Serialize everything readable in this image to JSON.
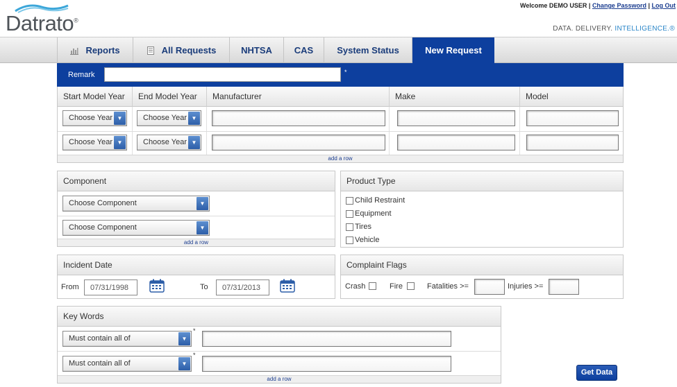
{
  "header": {
    "logo_text": "Datrato",
    "welcome": "Welcome DEMO USER",
    "change_password": "Change Password",
    "log_out": "Log Out",
    "tagline_main": "DATA. DELIVERY.",
    "tagline_accent": "INTELLIGENCE.",
    "tagline_mark": "®"
  },
  "nav": {
    "tabs": [
      {
        "label": "Reports",
        "icon": "bar-chart-icon"
      },
      {
        "label": "All Requests",
        "icon": "document-icon"
      },
      {
        "label": "NHTSA"
      },
      {
        "label": "CAS"
      },
      {
        "label": "System Status"
      },
      {
        "label": "New Request",
        "active": true
      }
    ]
  },
  "remark": {
    "label": "Remark",
    "value": "",
    "required_mark": "*"
  },
  "vehicle_table": {
    "headers": [
      "Start Model Year",
      "End Model Year",
      "Manufacturer",
      "Make",
      "Model"
    ],
    "rows": [
      {
        "start_year": "Choose Year",
        "end_year": "Choose Year",
        "manufacturer": "",
        "make": "",
        "model": ""
      },
      {
        "start_year": "Choose Year",
        "end_year": "Choose Year",
        "manufacturer": "",
        "make": "",
        "model": ""
      }
    ],
    "add_row": "add a row"
  },
  "component": {
    "title": "Component",
    "selects": [
      "Choose Component",
      "Choose Component"
    ],
    "add_row": "add a row"
  },
  "product_type": {
    "title": "Product Type",
    "options": [
      "Child Restraint",
      "Equipment",
      "Tires",
      "Vehicle"
    ]
  },
  "incident_date": {
    "title": "Incident Date",
    "from_label": "From",
    "from_value": "07/31/1998",
    "to_label": "To",
    "to_value": "07/31/2013"
  },
  "complaint_flags": {
    "title": "Complaint Flags",
    "crash_label": "Crash",
    "fire_label": "Fire",
    "fatalities_label": "Fatalities >=",
    "fatalities_value": "",
    "injuries_label": "Injuries >=",
    "injuries_value": ""
  },
  "key_words": {
    "title": "Key Words",
    "rows": [
      {
        "mode": "Must contain all of",
        "value": "",
        "required_mark": "*"
      },
      {
        "mode": "Must contain all of",
        "value": "",
        "required_mark": "*"
      }
    ],
    "add_row": "add a row"
  },
  "get_data_label": "Get Data",
  "colors": {
    "primary_blue": "#0d3f9e",
    "link_blue": "#1a3c8f",
    "accent": "#2a86c8"
  }
}
